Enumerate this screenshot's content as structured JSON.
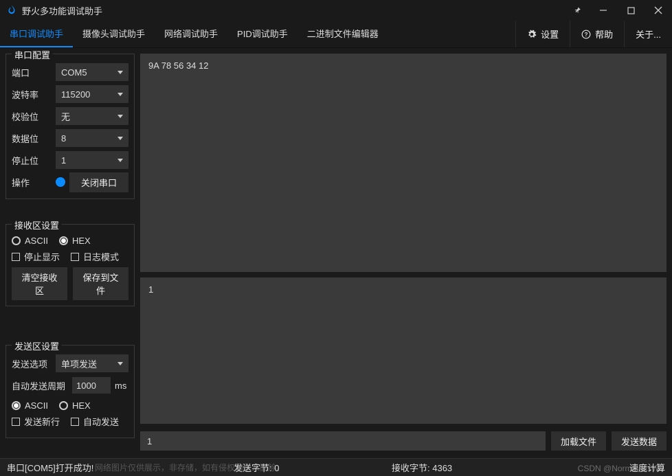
{
  "app": {
    "title": "野火多功能调试助手"
  },
  "tabs": [
    "串口调试助手",
    "摄像头调试助手",
    "网络调试助手",
    "PID调试助手",
    "二进制文件编辑器"
  ],
  "menu": {
    "settings": "设置",
    "help": "帮助",
    "about": "关于..."
  },
  "serial": {
    "title": "串口配置",
    "port_label": "端口",
    "port_value": "COM5",
    "baud_label": "波特率",
    "baud_value": "115200",
    "parity_label": "校验位",
    "parity_value": "无",
    "databits_label": "数据位",
    "databits_value": "8",
    "stopbits_label": "停止位",
    "stopbits_value": "1",
    "action_label": "操作",
    "action_button": "关闭串口"
  },
  "recv": {
    "title": "接收区设置",
    "ascii": "ASCII",
    "hex": "HEX",
    "stop": "停止显示",
    "log": "日志模式",
    "clear": "清空接收区",
    "save": "保存到文件",
    "content": "9A 78 56 34 12"
  },
  "send": {
    "title": "发送区设置",
    "option_label": "发送选项",
    "option_value": "单项发送",
    "period_label": "自动发送周期",
    "period_value": "1000",
    "period_unit": "ms",
    "ascii": "ASCII",
    "hex": "HEX",
    "newline": "发送新行",
    "auto": "自动发送",
    "content": "1",
    "combo_value": "1",
    "load_file": "加载文件",
    "send_btn": "发送数据"
  },
  "status": {
    "left": "串口[COM5]打开成功!",
    "tx_label": "发送字节: ",
    "tx_value": "0",
    "rx_label": "接收字节: ",
    "rx_value": "4363",
    "right": "速度计算"
  },
  "watermark": {
    "right": "CSDN @NormalattsWu",
    "left": "网络图片仅供展示，非存储，如有侵权请联系删除。"
  }
}
